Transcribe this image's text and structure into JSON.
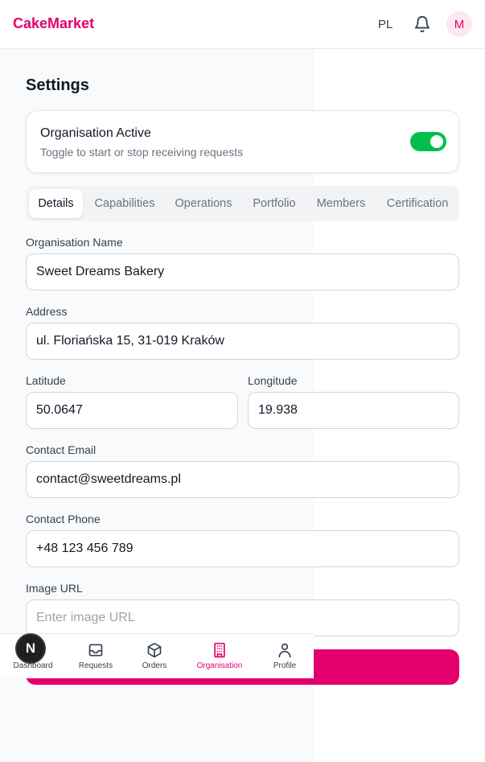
{
  "header": {
    "brand": "CakeMarket",
    "language": "PL",
    "avatar_initial": "M"
  },
  "page": {
    "title": "Settings"
  },
  "status_card": {
    "title": "Organisation Active",
    "subtitle": "Toggle to start or stop receiving requests",
    "active": true
  },
  "tabs": [
    {
      "label": "Details",
      "active": true
    },
    {
      "label": "Capabilities",
      "active": false
    },
    {
      "label": "Operations",
      "active": false
    },
    {
      "label": "Portfolio",
      "active": false
    },
    {
      "label": "Members",
      "active": false
    },
    {
      "label": "Certification",
      "active": false
    }
  ],
  "form": {
    "name": {
      "label": "Organisation Name",
      "value": "Sweet Dreams Bakery"
    },
    "address": {
      "label": "Address",
      "value": "ul. Floriańska 15, 31-019 Kraków"
    },
    "latitude": {
      "label": "Latitude",
      "value": "50.0647"
    },
    "longitude": {
      "label": "Longitude",
      "value": "19.938"
    },
    "email": {
      "label": "Contact Email",
      "value": "contact@sweetdreams.pl"
    },
    "phone": {
      "label": "Contact Phone",
      "value": "+48 123 456 789"
    },
    "image_url": {
      "label": "Image URL",
      "value": "",
      "placeholder": "Enter image URL"
    }
  },
  "bottom_nav": [
    {
      "label": "Dashboard",
      "icon": "dashboard-icon",
      "active": false
    },
    {
      "label": "Requests",
      "icon": "inbox-icon",
      "active": false
    },
    {
      "label": "Orders",
      "icon": "package-icon",
      "active": false
    },
    {
      "label": "Organisation",
      "icon": "building-icon",
      "active": true
    },
    {
      "label": "Profile",
      "icon": "user-icon",
      "active": false
    }
  ],
  "dev_badge": {
    "letter": "N"
  },
  "colors": {
    "brand": "#e2006f",
    "toggle_on": "#00c04b"
  }
}
